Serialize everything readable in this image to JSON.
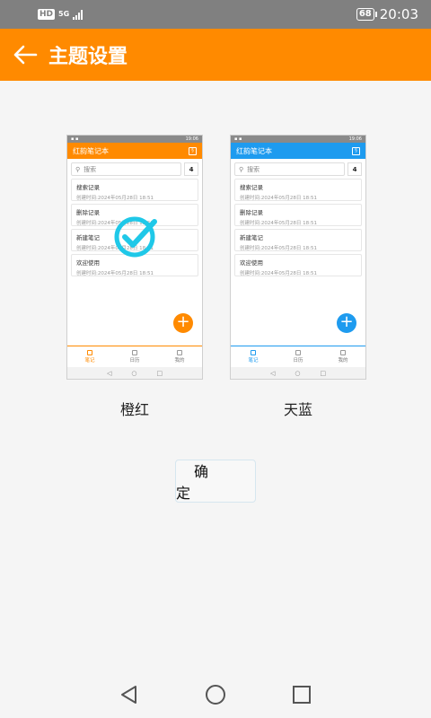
{
  "status_bar": {
    "hd": "HD",
    "network": "5G",
    "battery": "68",
    "time": "20:03"
  },
  "app_bar": {
    "title": "主题设置"
  },
  "preview": {
    "status_time": "19:06",
    "app_name": "红韵笔记本",
    "search_placeholder": "搜索",
    "note_count": "4",
    "notes": [
      {
        "title": "搜索记录",
        "date": "创建时间:2024年05月28日 18:51"
      },
      {
        "title": "删除记录",
        "date": "创建时间:2024年05月28日 18:51"
      },
      {
        "title": "新建笔记",
        "date": "创建时间:2024年05月28日 18:51"
      },
      {
        "title": "欢迎使用",
        "date": "创建时间:2024年05月28日 18:51"
      }
    ],
    "nav": [
      "笔记",
      "日历",
      "我的"
    ]
  },
  "themes": [
    {
      "label": "橙红",
      "color": "#ff8a00",
      "selected": true
    },
    {
      "label": "天蓝",
      "color": "#1e9bef",
      "selected": false
    }
  ],
  "check_color": "#1fc8e8",
  "confirm_button": {
    "label": "确定"
  }
}
